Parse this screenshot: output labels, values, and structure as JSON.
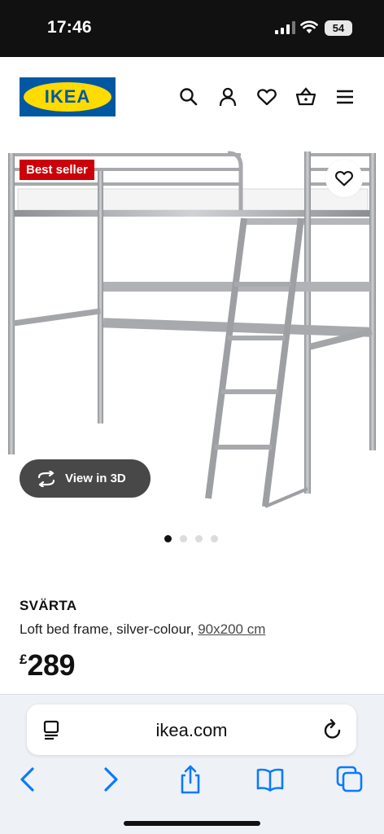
{
  "status_bar": {
    "time": "17:46",
    "battery": "54"
  },
  "header": {
    "logo_text": "IKEA",
    "icons": [
      "search-icon",
      "profile-icon",
      "heart-icon",
      "basket-icon",
      "menu-icon"
    ]
  },
  "media": {
    "badge": "Best seller",
    "view_3d_label": "View in 3D",
    "carousel": {
      "total": 4,
      "active_index": 0
    }
  },
  "product": {
    "name": "SVÄRTA",
    "description": "Loft bed frame, silver-colour, ",
    "size_link": "90x200 cm",
    "currency": "£",
    "price": "289"
  },
  "browser": {
    "domain": "ikea.com"
  },
  "colors": {
    "ikea_blue": "#0058a3",
    "ikea_yellow": "#ffdb00",
    "badge_red": "#cc0008",
    "ios_blue": "#0a7aff"
  }
}
